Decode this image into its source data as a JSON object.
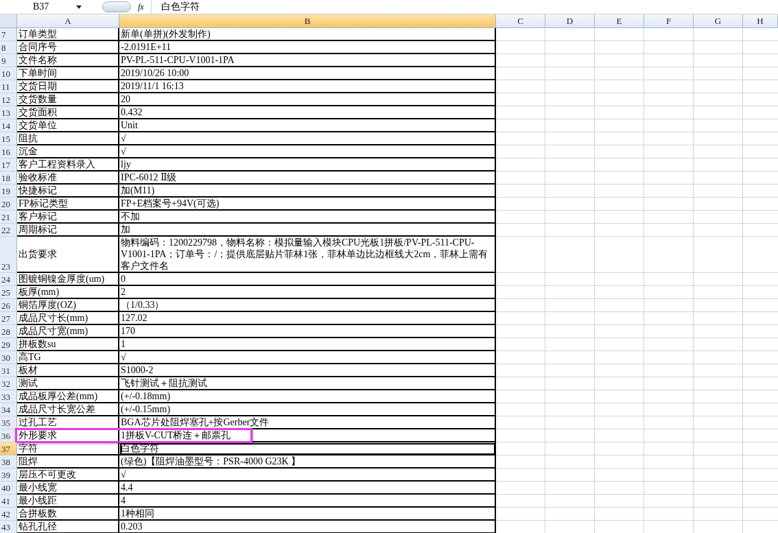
{
  "formula_bar": {
    "name_box": "B37",
    "fx": "fx",
    "value": "白色字符"
  },
  "columns": [
    {
      "label": "A",
      "selected": false
    },
    {
      "label": "B",
      "selected": true
    },
    {
      "label": "C",
      "selected": false
    },
    {
      "label": "D",
      "selected": false
    },
    {
      "label": "E",
      "selected": false
    },
    {
      "label": "F",
      "selected": false
    },
    {
      "label": "G",
      "selected": false
    },
    {
      "label": "H",
      "selected": false
    }
  ],
  "rows": [
    {
      "num": "7",
      "a": "订单类型",
      "b": "新单(单拼)(外发制作)",
      "selected": false,
      "highlighted": false
    },
    {
      "num": "8",
      "a": "合同序号",
      "b": "-2.0191E+11",
      "selected": false,
      "highlighted": false
    },
    {
      "num": "9",
      "a": "文件名称",
      "b": "PV-PL-511-CPU-V1001-1PA",
      "selected": false,
      "highlighted": false
    },
    {
      "num": "10",
      "a": "下单时间",
      "b": "2019/10/26 10:00",
      "selected": false,
      "highlighted": false
    },
    {
      "num": "11",
      "a": "交货日期",
      "b": "2019/11/1 16:13",
      "selected": false,
      "highlighted": false
    },
    {
      "num": "12",
      "a": "交货数量",
      "b": "20",
      "selected": false,
      "highlighted": false
    },
    {
      "num": "13",
      "a": "交货面积",
      "b": "0.432",
      "selected": false,
      "highlighted": false
    },
    {
      "num": "14",
      "a": "交货单位",
      "b": "Unit",
      "selected": false,
      "highlighted": false
    },
    {
      "num": "15",
      "a": "阻抗",
      "b": "√",
      "selected": false,
      "highlighted": false
    },
    {
      "num": "16",
      "a": "沉金",
      "b": "√",
      "selected": false,
      "highlighted": false
    },
    {
      "num": "17",
      "a": "客户工程资料录入",
      "b": "ljy",
      "selected": false,
      "highlighted": false
    },
    {
      "num": "18",
      "a": "验收标准",
      "b": "IPC-6012 Ⅱ级",
      "selected": false,
      "highlighted": false
    },
    {
      "num": "19",
      "a": "快捷标记",
      "b": "加(M11)",
      "selected": false,
      "highlighted": false
    },
    {
      "num": "20",
      "a": "FP标记类型",
      "b": "FP+E档案号+94V(可选)",
      "selected": false,
      "highlighted": false
    },
    {
      "num": "21",
      "a": "客户标记",
      "b": "不加",
      "selected": false,
      "highlighted": false
    },
    {
      "num": "22",
      "a": "周期标记",
      "b": "加",
      "selected": false,
      "highlighted": false
    },
    {
      "num": "23",
      "a": "出货要求",
      "b": "物料编码：1200229798，物料名称：模拟量输入模块CPU光板1拼板/PV-PL-511-CPU-V1001-1PA；订单号：/；提供底层贴片菲林1张，菲林单边比边框线大2cm，菲林上需有客户文件名",
      "selected": false,
      "highlighted": false
    },
    {
      "num": "24",
      "a": "图镀铜镍金厚度(um)",
      "b": "0",
      "selected": false,
      "highlighted": false
    },
    {
      "num": "25",
      "a": "板厚(mm)",
      "b": "2",
      "selected": false,
      "highlighted": false
    },
    {
      "num": "26",
      "a": "铜箔厚度(OZ)",
      "b": "（1/0.33）",
      "selected": false,
      "highlighted": false
    },
    {
      "num": "27",
      "a": "成品尺寸长(mm)",
      "b": "127.02",
      "selected": false,
      "highlighted": false
    },
    {
      "num": "28",
      "a": "成品尺寸宽(mm)",
      "b": "170",
      "selected": false,
      "highlighted": false
    },
    {
      "num": "29",
      "a": "拼板数su",
      "b": "1",
      "selected": false,
      "highlighted": false
    },
    {
      "num": "30",
      "a": "高TG",
      "b": "√",
      "selected": false,
      "highlighted": false
    },
    {
      "num": "31",
      "a": "板材",
      "b": "S1000-2",
      "selected": false,
      "highlighted": false
    },
    {
      "num": "32",
      "a": "测试",
      "b": "飞针测试＋阻抗测试",
      "selected": false,
      "highlighted": false
    },
    {
      "num": "33",
      "a": "成品板厚公差(mm)",
      "b": "(+/-0.18mm)",
      "selected": false,
      "highlighted": false
    },
    {
      "num": "34",
      "a": "成品尺寸长宽公差",
      "b": "(+/-0.15mm)",
      "selected": false,
      "highlighted": false
    },
    {
      "num": "35",
      "a": "过孔工艺",
      "b": "BGA芯片处阻焊塞孔+按Gerber文件",
      "selected": false,
      "highlighted": false
    },
    {
      "num": "36",
      "a": "外形要求",
      "b": "1拼板V-CUT桥连＋邮票孔",
      "selected": false,
      "highlighted": true
    },
    {
      "num": "37",
      "a": "字符",
      "b": "白色字符",
      "selected": true,
      "highlighted": false
    },
    {
      "num": "38",
      "a": "阻焊",
      "b": "(绿色)【阻焊油墨型号：PSR-4000 G23K 】",
      "selected": false,
      "highlighted": false
    },
    {
      "num": "39",
      "a": "层压不可更改",
      "b": "√",
      "selected": false,
      "highlighted": false
    },
    {
      "num": "40",
      "a": "最小线宽",
      "b": "4.4",
      "selected": false,
      "highlighted": false
    },
    {
      "num": "41",
      "a": "最小线距",
      "b": "4",
      "selected": false,
      "highlighted": false
    },
    {
      "num": "42",
      "a": "合拼板数",
      "b": "1种相同",
      "selected": false,
      "highlighted": false
    },
    {
      "num": "43",
      "a": "钻孔孔径",
      "b": "0.203",
      "selected": false,
      "highlighted": false
    }
  ]
}
